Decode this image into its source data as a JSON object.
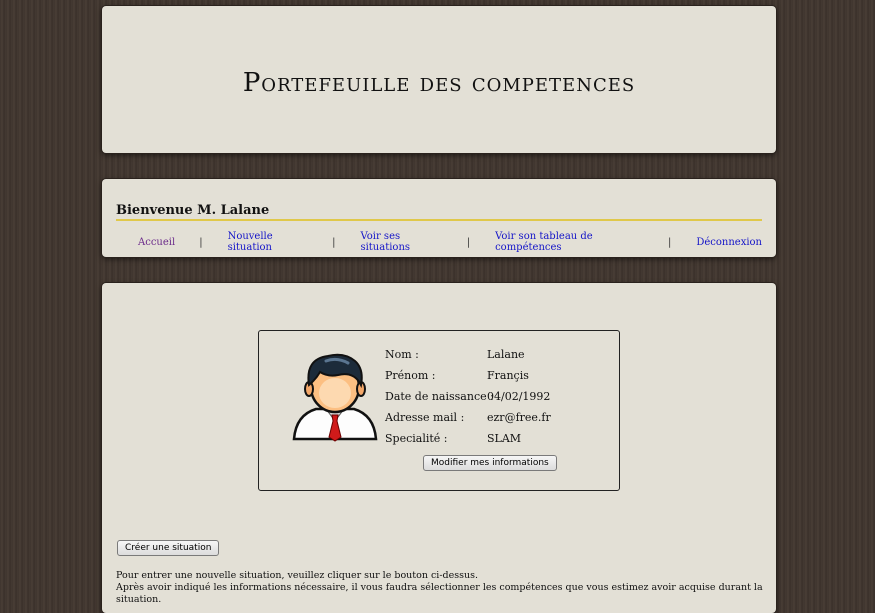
{
  "header": {
    "title": "Portefeuille des competences"
  },
  "nav": {
    "welcome": "Bienvenue M. Lalane",
    "links": [
      "Accueil",
      "Nouvelle situation",
      "Voir ses situations",
      "Voir son tableau de compétences",
      "Déconnexion"
    ],
    "separator": "|"
  },
  "profile": {
    "avatar_icon": "user-avatar-icon",
    "fields": [
      {
        "label": "Nom :",
        "value": "Lalane"
      },
      {
        "label": "Prénom :",
        "value": "Françis"
      },
      {
        "label": "Date de naissance :",
        "value": "04/02/1992"
      },
      {
        "label": "Adresse mail :",
        "value": "ezr@free.fr"
      },
      {
        "label": "Specialité :",
        "value": "SLAM"
      }
    ],
    "modify_button": "Modifier mes informations"
  },
  "actions": {
    "create_button": "Créer une situation"
  },
  "instructions": {
    "line1": "Pour entrer une nouvelle situation, veuillez cliquer sur le bouton ci-dessus.",
    "line2": "Après avoir indiqué les informations nécessaire, il vous faudra sélectionner les compétences que vous estimez avoir acquise durant la situation."
  },
  "colors": {
    "accent_line": "#e0c84a",
    "link": "#1515c8",
    "visited_link": "#6b2a8a"
  }
}
